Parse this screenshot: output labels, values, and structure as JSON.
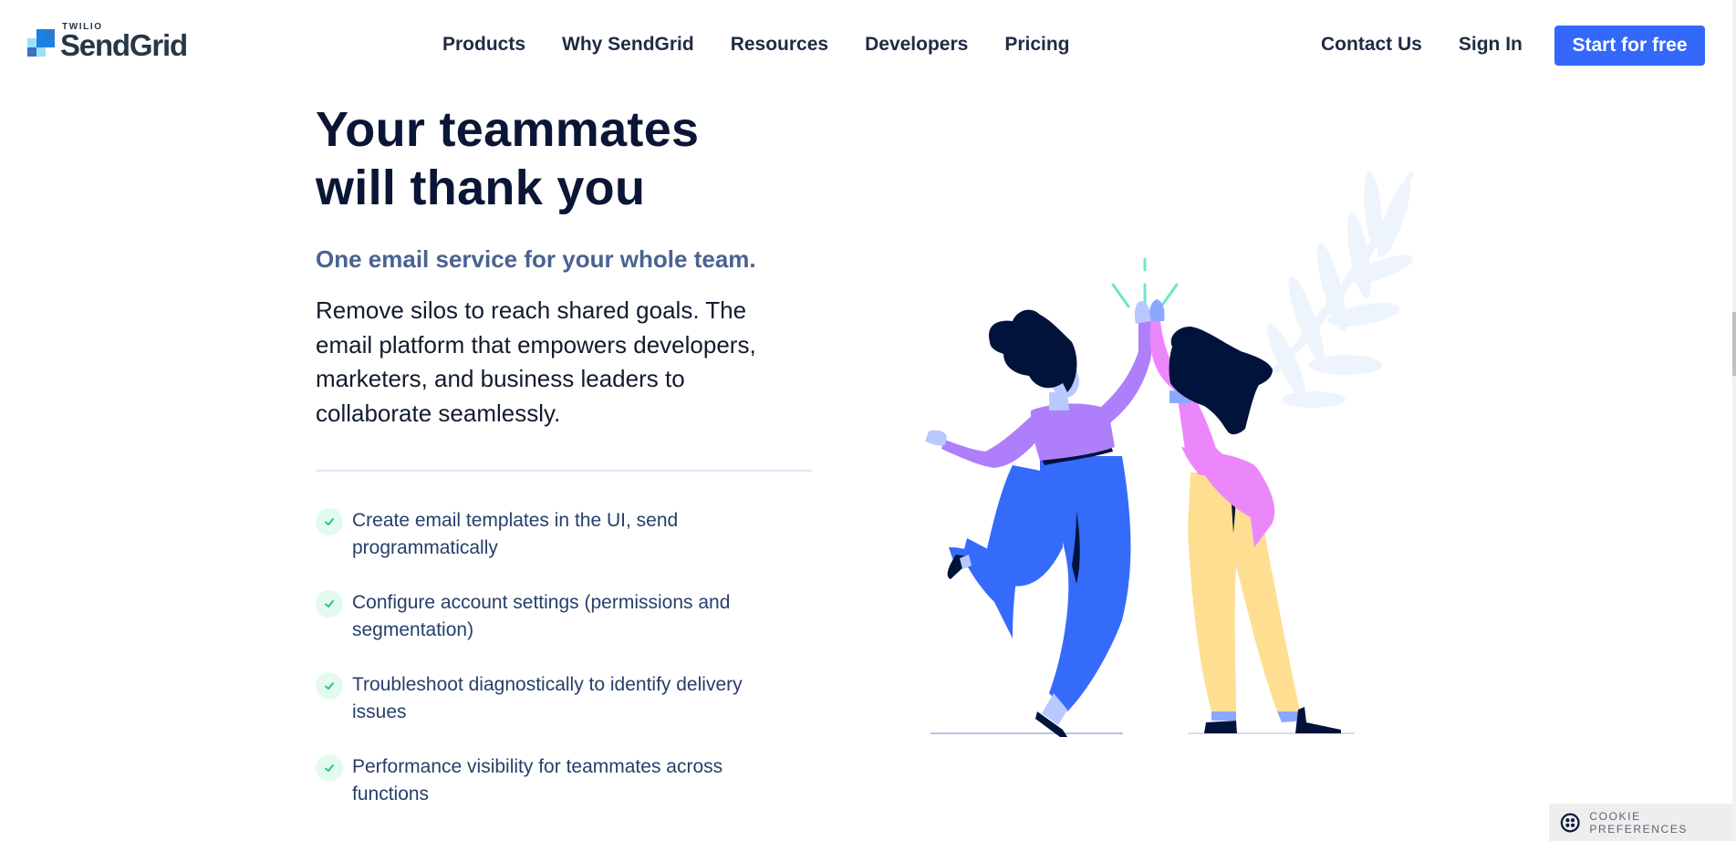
{
  "header": {
    "logo": {
      "small_text": "TWILIO",
      "brand_text": "SendGrid"
    },
    "nav": [
      {
        "label": "Products"
      },
      {
        "label": "Why SendGrid"
      },
      {
        "label": "Resources"
      },
      {
        "label": "Developers"
      },
      {
        "label": "Pricing"
      }
    ],
    "right_nav": [
      {
        "label": "Contact Us"
      },
      {
        "label": "Sign In"
      }
    ],
    "cta_label": "Start for free"
  },
  "main": {
    "headline": "Your teammates will thank you",
    "subheading": "One email service for your whole team.",
    "body": "Remove silos to reach shared goals. The email platform that empowers developers, marketers, and business leaders to collaborate seamlessly.",
    "features": [
      {
        "icon": "check-icon",
        "text": "Create email templates in the UI, send programmatically"
      },
      {
        "icon": "check-icon",
        "text": "Configure account settings (permissions and segmentation)"
      },
      {
        "icon": "check-icon",
        "text": "Troubleshoot diagnostically to identify delivery issues"
      },
      {
        "icon": "check-icon",
        "text": "Performance visibility for teammates across functions"
      }
    ]
  },
  "illustration": {
    "description": "two-people-high-five"
  },
  "cookie": {
    "label": "COOKIE PREFERENCES",
    "icon": "twilio-icon"
  },
  "colors": {
    "brand_blue": "#3368fa",
    "heading": "#0b1536",
    "subheading": "#4a6390",
    "check_bg": "#e2fbee",
    "check": "#2bc38a"
  }
}
